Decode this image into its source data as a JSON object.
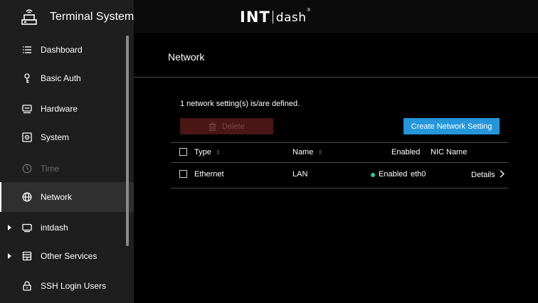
{
  "brand": {
    "title": "Terminal System",
    "icon": "terminal-device-icon"
  },
  "logo": {
    "left": "INT",
    "right": "dash",
    "reg": "®"
  },
  "sidebar": {
    "items": [
      {
        "label": "Dashboard",
        "icon": "list-icon"
      },
      {
        "label": "Basic Auth",
        "icon": "key-icon"
      },
      {
        "label": "Hardware",
        "icon": "hardware-icon"
      },
      {
        "label": "System",
        "icon": "system-icon"
      },
      {
        "label": "Time",
        "icon": "clock-icon",
        "disabled": true
      },
      {
        "label": "Network",
        "icon": "globe-icon",
        "active": true
      },
      {
        "label": "intdash",
        "icon": "monitor-icon",
        "expandable": true
      },
      {
        "label": "Other Services",
        "icon": "services-icon",
        "expandable": true
      },
      {
        "label": "SSH Login Users",
        "icon": "lock-icon"
      }
    ]
  },
  "main": {
    "title": "Network",
    "summary": "1 network setting(s) is/are defined.",
    "delete_label": "Delete",
    "create_label": "Create Network Setting",
    "table": {
      "headers": {
        "type": "Type",
        "name": "Name",
        "enabled": "Enabled",
        "nic": "NIC Name"
      },
      "rows": [
        {
          "type": "Ethernet",
          "name": "LAN",
          "enabled": "Enabled",
          "nic": "eth0",
          "action": "Details"
        }
      ]
    }
  },
  "colors": {
    "accent": "#2596d9",
    "danger_disabled": "#4a1616",
    "enabled_dot": "#25c9a8",
    "sidebar_bg": "#1e1e1e"
  }
}
